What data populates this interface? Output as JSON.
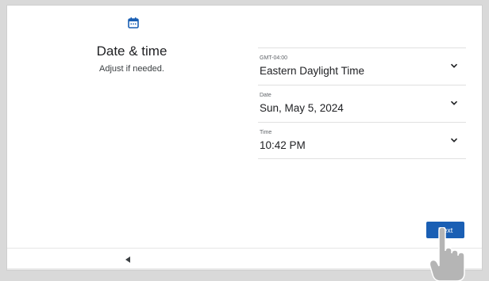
{
  "header": {
    "icon": "calendar-icon",
    "title": "Date & time",
    "subtitle": "Adjust if needed."
  },
  "settings": [
    {
      "caption": "GMT-04:00",
      "value": "Eastern Daylight Time",
      "icon": "chevron-down-icon"
    },
    {
      "caption": "Date",
      "value": "Sun, May 5, 2024",
      "icon": "chevron-down-icon"
    },
    {
      "caption": "Time",
      "value": "10:42 PM",
      "icon": "chevron-down-icon"
    }
  ],
  "actions": {
    "next_label": "Next"
  },
  "nav": {
    "back_icon": "back-triangle-icon"
  },
  "overlay": {
    "icon": "pointing-hand-icon"
  },
  "colors": {
    "accent": "#1a5fb4",
    "calendar_icon": "#1a5fb4",
    "text": "#202124"
  }
}
